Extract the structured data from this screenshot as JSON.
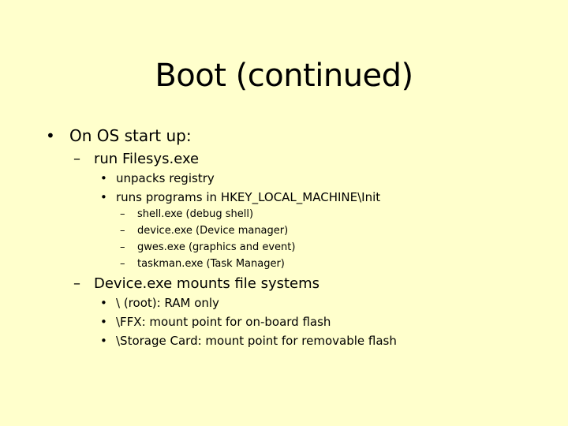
{
  "slide": {
    "background_color": "#FFFFCC",
    "title": "Boot (continued)",
    "markers": {
      "bullet": "•",
      "dash": "–"
    },
    "items": [
      {
        "level": 1,
        "marker": "•",
        "text": "On OS start up:"
      },
      {
        "level": 2,
        "marker": "–",
        "text": "run Filesys.exe"
      },
      {
        "level": 3,
        "marker": "•",
        "text": "unpacks registry"
      },
      {
        "level": 3,
        "marker": "•",
        "text": "runs programs in HKEY_LOCAL_MACHINE\\Init"
      },
      {
        "level": 4,
        "marker": "–",
        "text": "shell.exe (debug shell)"
      },
      {
        "level": 4,
        "marker": "–",
        "text": "device.exe (Device manager)"
      },
      {
        "level": 4,
        "marker": "–",
        "text": "gwes.exe (graphics and event)"
      },
      {
        "level": 4,
        "marker": "–",
        "text": "taskman.exe (Task Manager)"
      },
      {
        "level": 2,
        "marker": "–",
        "text": "Device.exe mounts file systems"
      },
      {
        "level": 3,
        "marker": "•",
        "text": "\\ (root):  RAM only"
      },
      {
        "level": 3,
        "marker": "•",
        "text": "\\FFX:  mount point for on-board flash"
      },
      {
        "level": 3,
        "marker": "•",
        "text": "\\Storage Card:  mount point for removable flash"
      }
    ]
  }
}
